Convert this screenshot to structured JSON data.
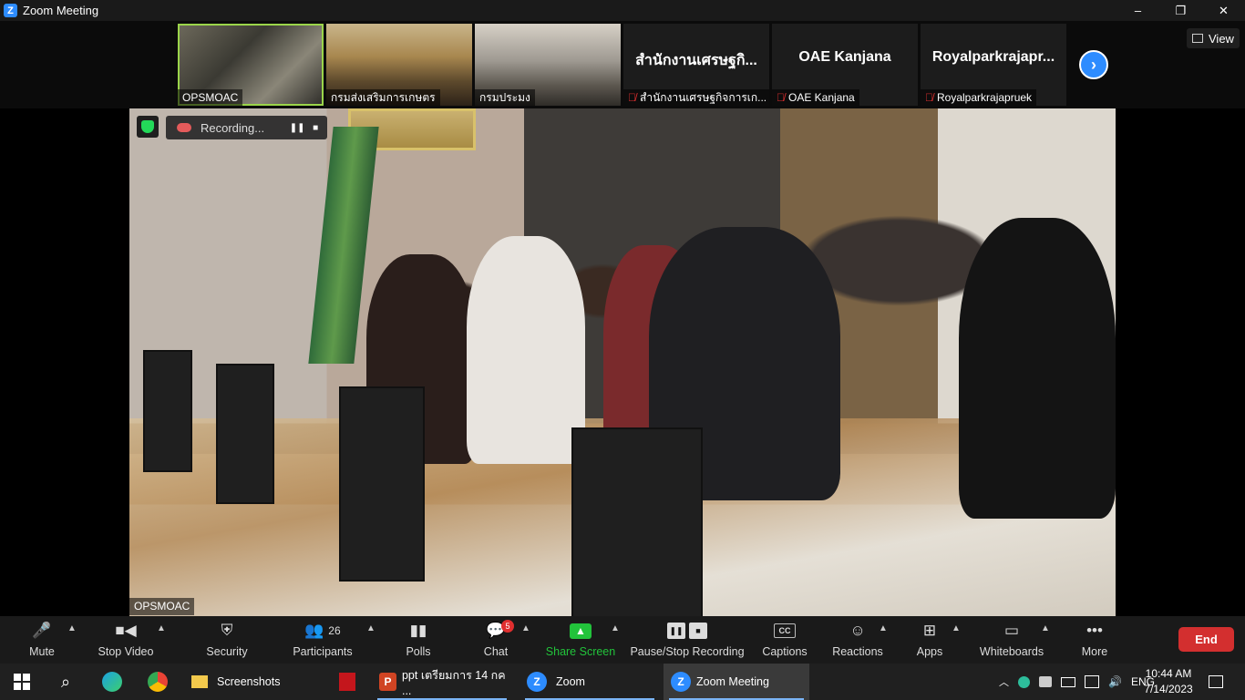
{
  "window": {
    "title": "Zoom Meeting",
    "controls": [
      "–",
      "❐",
      "✕"
    ]
  },
  "thumbnails": [
    {
      "name": "OPSMOAC",
      "type": "video",
      "active": true
    },
    {
      "name": "กรมส่งเสริมการเกษตร",
      "type": "video",
      "active": false
    },
    {
      "name": "กรมประมง",
      "type": "video",
      "active": false
    },
    {
      "title": "สำนักงานเศรษฐกิ...",
      "name": "สำนักงานเศรษฐกิจการเก...",
      "type": "avatar",
      "muted": true
    },
    {
      "title": "OAE Kanjana",
      "name": "OAE Kanjana",
      "type": "avatar",
      "muted": true
    },
    {
      "title": "Royalparkrajapr...",
      "name": "Royalparkrajapruek",
      "type": "avatar",
      "muted": true
    }
  ],
  "view_button": "View",
  "recording": {
    "label": "Recording..."
  },
  "main_speaker": "OPSMOAC",
  "toolbar": {
    "mute": "Mute",
    "stop_video": "Stop Video",
    "security": "Security",
    "participants": "Participants",
    "participants_count": "26",
    "polls": "Polls",
    "chat": "Chat",
    "chat_badge": "5",
    "share_screen": "Share Screen",
    "pause_stop_recording": "Pause/Stop Recording",
    "captions": "Captions",
    "reactions": "Reactions",
    "apps": "Apps",
    "whiteboards": "Whiteboards",
    "more": "More",
    "end": "End"
  },
  "taskbar": {
    "items": [
      {
        "label": "Screenshots"
      },
      {
        "label": "ppt เตรียมการ 14 กค ..."
      },
      {
        "label": "Zoom"
      },
      {
        "label": "Zoom Meeting"
      }
    ],
    "lang": "ENG",
    "time": "10:44 AM",
    "date": "7/14/2023"
  },
  "colors": {
    "accent": "#2d8cff",
    "share_green": "#22c33b",
    "end_red": "#d32f2f",
    "active_border": "#9bd54a"
  }
}
